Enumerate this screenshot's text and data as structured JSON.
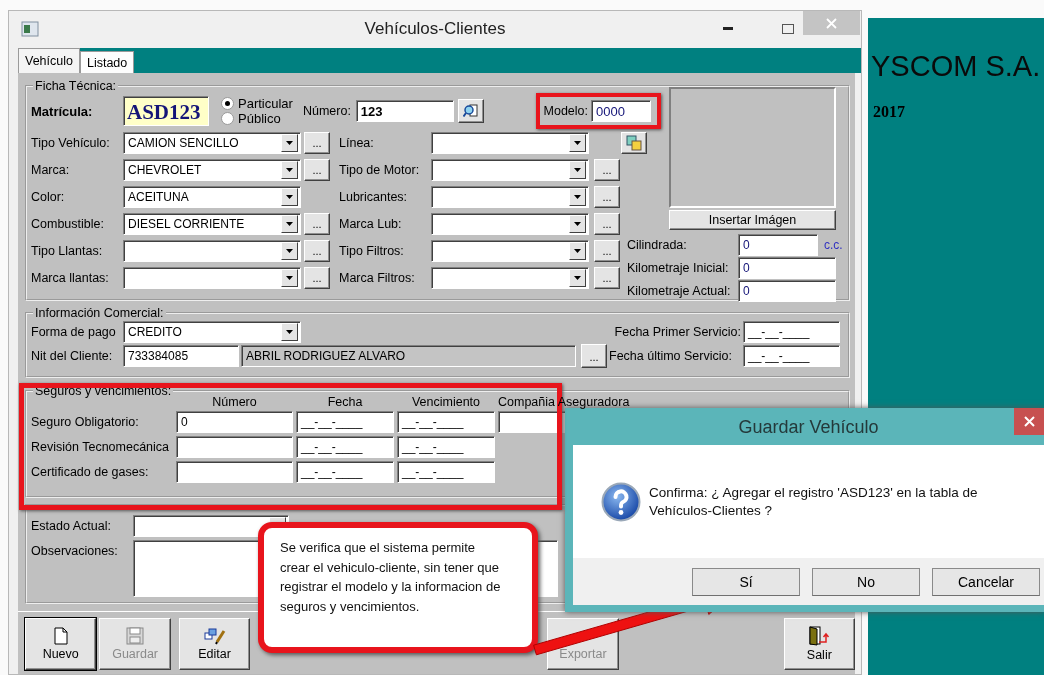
{
  "window": {
    "title": "Vehículos-Clientes"
  },
  "tabs": [
    {
      "label": "Vehículo",
      "selected": true
    },
    {
      "label": "Listado",
      "selected": false
    }
  ],
  "ficha_tecnica": {
    "title": "Ficha Técnica:",
    "matricula": {
      "label": "Matrícula:",
      "value": "ASD123"
    },
    "service_type": [
      {
        "label": "Particular",
        "selected": true
      },
      {
        "label": "Público",
        "selected": false
      }
    ],
    "numero": {
      "label": "Número:",
      "value": "123"
    },
    "modelo": {
      "label": "Modelo:",
      "value": "0000",
      "highlighted": true
    },
    "left_fields": [
      {
        "label": "Tipo Vehículo:",
        "value": "CAMION SENCILLO",
        "button": "..."
      },
      {
        "label": "Marca:",
        "value": "CHEVROLET",
        "button": "..."
      },
      {
        "label": "Color:",
        "value": "ACEITUNA"
      },
      {
        "label": "Combustible:",
        "value": "DIESEL CORRIENTE",
        "button": "..."
      },
      {
        "label": "Tipo Llantas:",
        "button": "..."
      },
      {
        "label": "Marca llantas:",
        "button": "..."
      }
    ],
    "right_fields": [
      {
        "label": "Línea:"
      },
      {
        "label": "Tipo de Motor:",
        "button": "..."
      },
      {
        "label": "Lubricantes:",
        "button": "..."
      },
      {
        "label": "Marca Lub:",
        "button": "..."
      },
      {
        "label": "Tipo Filtros:",
        "button": "..."
      },
      {
        "label": "Marca Filtros:",
        "button": "..."
      }
    ],
    "image_button": "Insertar Imágen",
    "measures": [
      {
        "label": "Cilindrada:",
        "value": "0",
        "unit": "c.c."
      },
      {
        "label": "Kilometraje Inicial:",
        "value": "0"
      },
      {
        "label": "Kilometraje Actual:",
        "value": "0"
      }
    ]
  },
  "informacion_comercial": {
    "title": "Información Comercial:",
    "forma_de_pago": {
      "label": "Forma de pago",
      "value": "CREDITO"
    },
    "cliente": {
      "label": "Nit del Cliente:",
      "nit": "733384085",
      "name": "ABRIL RODRIGUEZ ALVARO",
      "button": "..."
    },
    "fechas": [
      {
        "label": "Fecha Primer Servicio:",
        "value": "__-__-____"
      },
      {
        "label": "Fecha último Servicio:",
        "value": "__-__-____"
      }
    ]
  },
  "seguros": {
    "title": "Seguros y vencimientos:",
    "highlighted": true,
    "columns": [
      "Número",
      "Fecha",
      "Vencimiento",
      "Compañia Aseguradora"
    ],
    "rows": [
      {
        "label": "Seguro Obligatorio:",
        "numero": "0",
        "fecha": "__-__-____",
        "vencimiento": "__-__-____",
        "company_field": true
      },
      {
        "label": "Revisión Tecnomecánica",
        "fecha": "__-__-____",
        "vencimiento": "__-__-____",
        "company_field": false
      },
      {
        "label": "Certificado de gases:",
        "fecha": "__-__-____",
        "vencimiento": "__-__-____",
        "company_field": false
      }
    ]
  },
  "estado": {
    "label": "Estado Actual:"
  },
  "observaciones": {
    "label": "Observaciones:"
  },
  "toolbar": [
    {
      "label": "Nuevo",
      "kind": "new",
      "disabled": false,
      "default": true
    },
    {
      "label": "Guardar",
      "kind": "save",
      "disabled": true,
      "default": false
    },
    {
      "label": "Editar",
      "kind": "edit",
      "disabled": false,
      "default": false
    },
    {
      "label": "Exportar",
      "disabled": true,
      "default": false
    },
    {
      "label": "Salir",
      "kind": "exit",
      "disabled": false,
      "default": false
    }
  ],
  "side_panel": {
    "company": "YSCOM S.A.",
    "year": "2017"
  },
  "dialog": {
    "title": "Guardar Vehículo",
    "message": "Confirma: ¿ Agregar el registro 'ASD123' en la tabla de Vehículos-Clientes ?",
    "buttons": [
      "Sí",
      "No",
      "Cancelar"
    ]
  },
  "callout": {
    "text": "Se verifica que el sistema permite crear el vehiculo-cliente, sin tener que registrar el modelo y la informacion de seguros y vencimientos."
  }
}
